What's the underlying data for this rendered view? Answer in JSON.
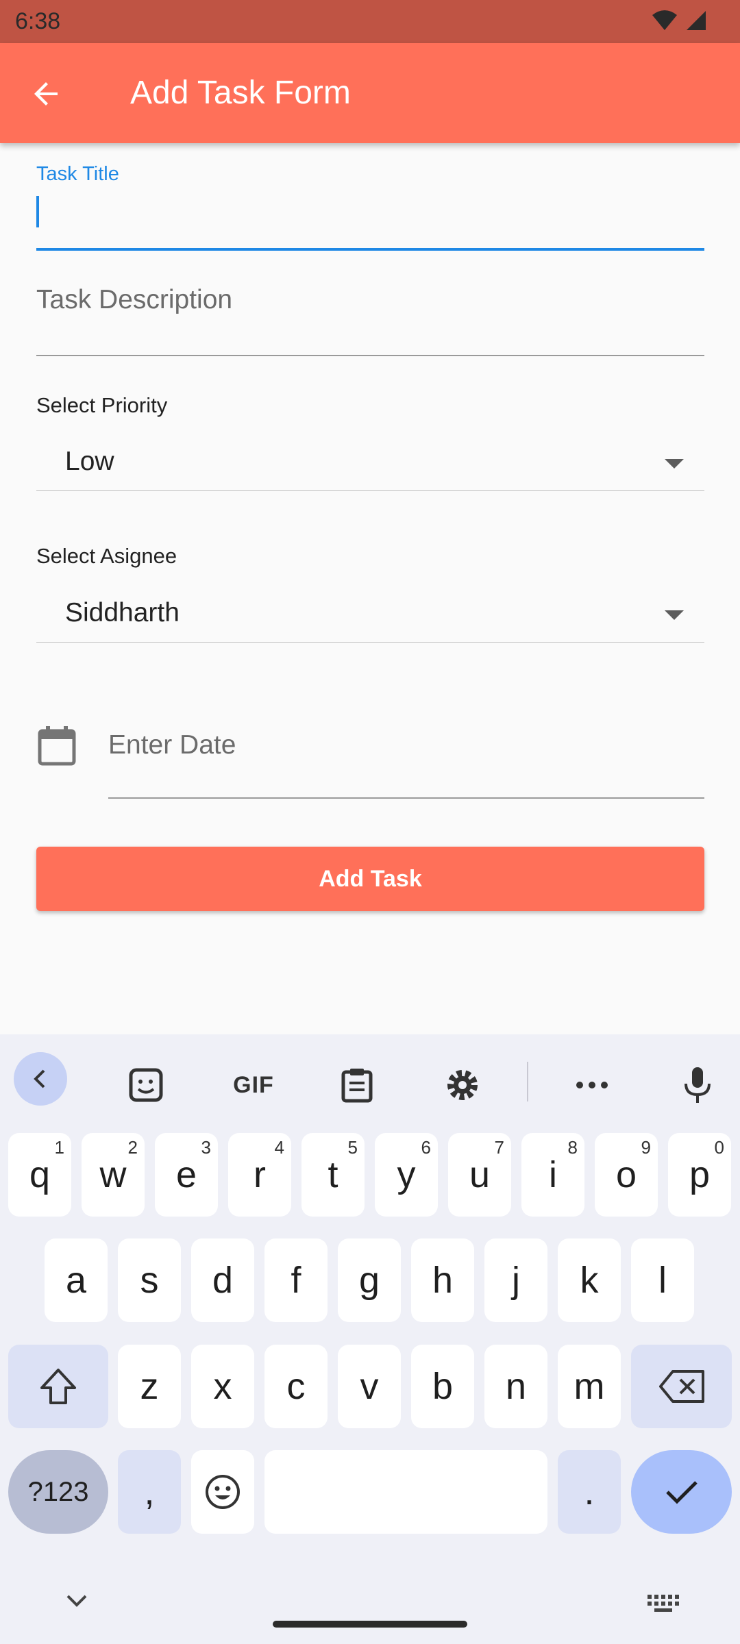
{
  "status_bar": {
    "time": "6:38"
  },
  "app_bar": {
    "title": "Add Task Form"
  },
  "form": {
    "task_title_label": "Task Title",
    "task_title_value": "",
    "task_description_placeholder": "Task Description",
    "priority_label": "Select Priority",
    "priority_value": "Low",
    "assignee_label": "Select Asignee",
    "assignee_value": "Siddharth",
    "date_placeholder": "Enter Date",
    "submit_label": "Add Task"
  },
  "colors": {
    "accent": "#ff7059",
    "focus": "#1e88e5",
    "status_bar": "#bf5444"
  },
  "keyboard": {
    "toolbar": [
      "chevron-left-icon",
      "sticker-icon",
      "GIF",
      "clipboard-icon",
      "gear-icon",
      "more-icon",
      "mic-icon"
    ],
    "toolbar_gif": "GIF",
    "row1": [
      {
        "k": "q",
        "h": "1"
      },
      {
        "k": "w",
        "h": "2"
      },
      {
        "k": "e",
        "h": "3"
      },
      {
        "k": "r",
        "h": "4"
      },
      {
        "k": "t",
        "h": "5"
      },
      {
        "k": "y",
        "h": "6"
      },
      {
        "k": "u",
        "h": "7"
      },
      {
        "k": "i",
        "h": "8"
      },
      {
        "k": "o",
        "h": "9"
      },
      {
        "k": "p",
        "h": "0"
      }
    ],
    "row2": [
      "a",
      "s",
      "d",
      "f",
      "g",
      "h",
      "j",
      "k",
      "l"
    ],
    "row3": [
      "z",
      "x",
      "c",
      "v",
      "b",
      "n",
      "m"
    ],
    "sym_label": "?123",
    "comma": ",",
    "period": "."
  }
}
